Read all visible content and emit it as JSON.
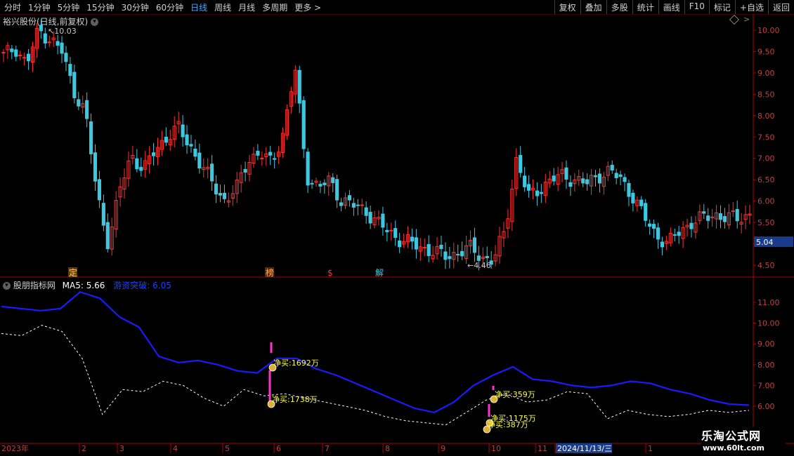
{
  "toolbar": {
    "periods": [
      "分时",
      "1分钟",
      "5分钟",
      "15分钟",
      "30分钟",
      "60分钟",
      "日线",
      "周线",
      "月线",
      "多周期",
      "更多 >"
    ],
    "active_period": "日线",
    "actions": [
      "复权",
      "叠加",
      "多股",
      "统计",
      "画线",
      "F10",
      "标记",
      "+自选",
      "返回"
    ]
  },
  "stock_title": "裕兴股份(日线,前复权)",
  "indicator": {
    "name": "股朋指标网",
    "ma_label": "MA5: 5.66",
    "ind_label": "游资突破: 6.05"
  },
  "logo": {
    "line1": "乐淘公式网",
    "line2": "www.60lt.com"
  },
  "colors": {
    "up": "#ff3030",
    "down": "#3ec8e0",
    "ma": "#1a1aff",
    "dash": "#ffffff",
    "pink": "#ff33cc",
    "label": "#ffff44",
    "axis": "#b00000"
  },
  "chart_data": [
    {
      "type": "candlestick",
      "title": "裕兴股份(日线,前复权)",
      "y_ticks": [
        "10.00",
        "9.50",
        "9.00",
        "8.50",
        "8.00",
        "7.50",
        "7.00",
        "6.50",
        "6.00",
        "5.50",
        "5.00",
        "4.50"
      ],
      "ylim": [
        4.3,
        10.25
      ],
      "current_price_tag": "5.04",
      "annotations": [
        {
          "text": "10.03",
          "type": "high"
        },
        {
          "text": "4.46",
          "type": "low"
        }
      ],
      "event_markers": [
        "定",
        "榜",
        "$",
        "解"
      ],
      "note": "approx. 180 daily candles",
      "key_path": [
        9.4,
        9.6,
        9.2,
        10.0,
        9.8,
        9.5,
        8.6,
        8.1,
        6.2,
        5.0,
        6.3,
        7.1,
        6.7,
        7.2,
        7.5,
        7.7,
        7.3,
        6.8,
        6.4,
        6.0,
        6.3,
        7.0,
        7.1,
        6.9,
        7.6,
        9.1,
        6.6,
        6.3,
        6.5,
        6.0,
        5.9,
        5.8,
        5.5,
        5.3,
        5.1,
        5.0,
        4.9,
        4.8,
        4.7,
        4.8,
        4.9,
        4.7,
        4.6,
        5.3,
        7.0,
        6.1,
        6.3,
        6.5,
        6.6,
        6.5,
        6.4,
        6.6,
        6.7,
        6.5,
        6.1,
        5.6,
        5.2,
        5.0,
        5.3,
        5.5,
        5.6,
        5.7,
        5.6,
        5.6,
        5.7
      ]
    },
    {
      "type": "line",
      "title": "股朋指标网",
      "y_ticks": [
        "11.00",
        "10.00",
        "9.00",
        "8.00",
        "7.00",
        "6.00"
      ],
      "ylim": [
        5.2,
        12.0
      ],
      "series": [
        {
          "name": "MA5",
          "style": "solid",
          "values": [
            10.8,
            10.7,
            10.6,
            10.7,
            11.5,
            11.2,
            10.3,
            9.8,
            8.4,
            8.1,
            8.2,
            8.0,
            7.7,
            7.6,
            8.3,
            8.3,
            7.8,
            7.5,
            7.1,
            6.7,
            6.3,
            5.9,
            5.7,
            6.2,
            7.0,
            7.5,
            7.9,
            7.3,
            7.2,
            7.0,
            6.9,
            7.0,
            7.2,
            7.1,
            6.8,
            6.6,
            6.3,
            6.1,
            6.05
          ]
        },
        {
          "name": "游资突破",
          "style": "dashed",
          "values": [
            9.5,
            9.4,
            9.9,
            9.6,
            8.3,
            5.6,
            6.8,
            6.7,
            7.2,
            7.0,
            6.4,
            6.0,
            6.8,
            6.5,
            6.6,
            6.4,
            6.2,
            6.0,
            5.8,
            5.5,
            5.3,
            5.2,
            5.1,
            5.7,
            6.3,
            6.6,
            6.2,
            6.3,
            6.7,
            6.6,
            5.4,
            5.8,
            5.6,
            5.5,
            5.6,
            5.8,
            5.7,
            5.8
          ]
        }
      ],
      "labels": [
        "净买:1692万",
        "净买:1738万",
        "净买:359万",
        "净买:1175万",
        "净买:387万"
      ],
      "x_ticks": [
        "2023年",
        "2",
        "3",
        "4",
        "5",
        "6",
        "7",
        "8",
        "9",
        "10",
        "11",
        "2024/11/13/三",
        "1"
      ]
    }
  ]
}
